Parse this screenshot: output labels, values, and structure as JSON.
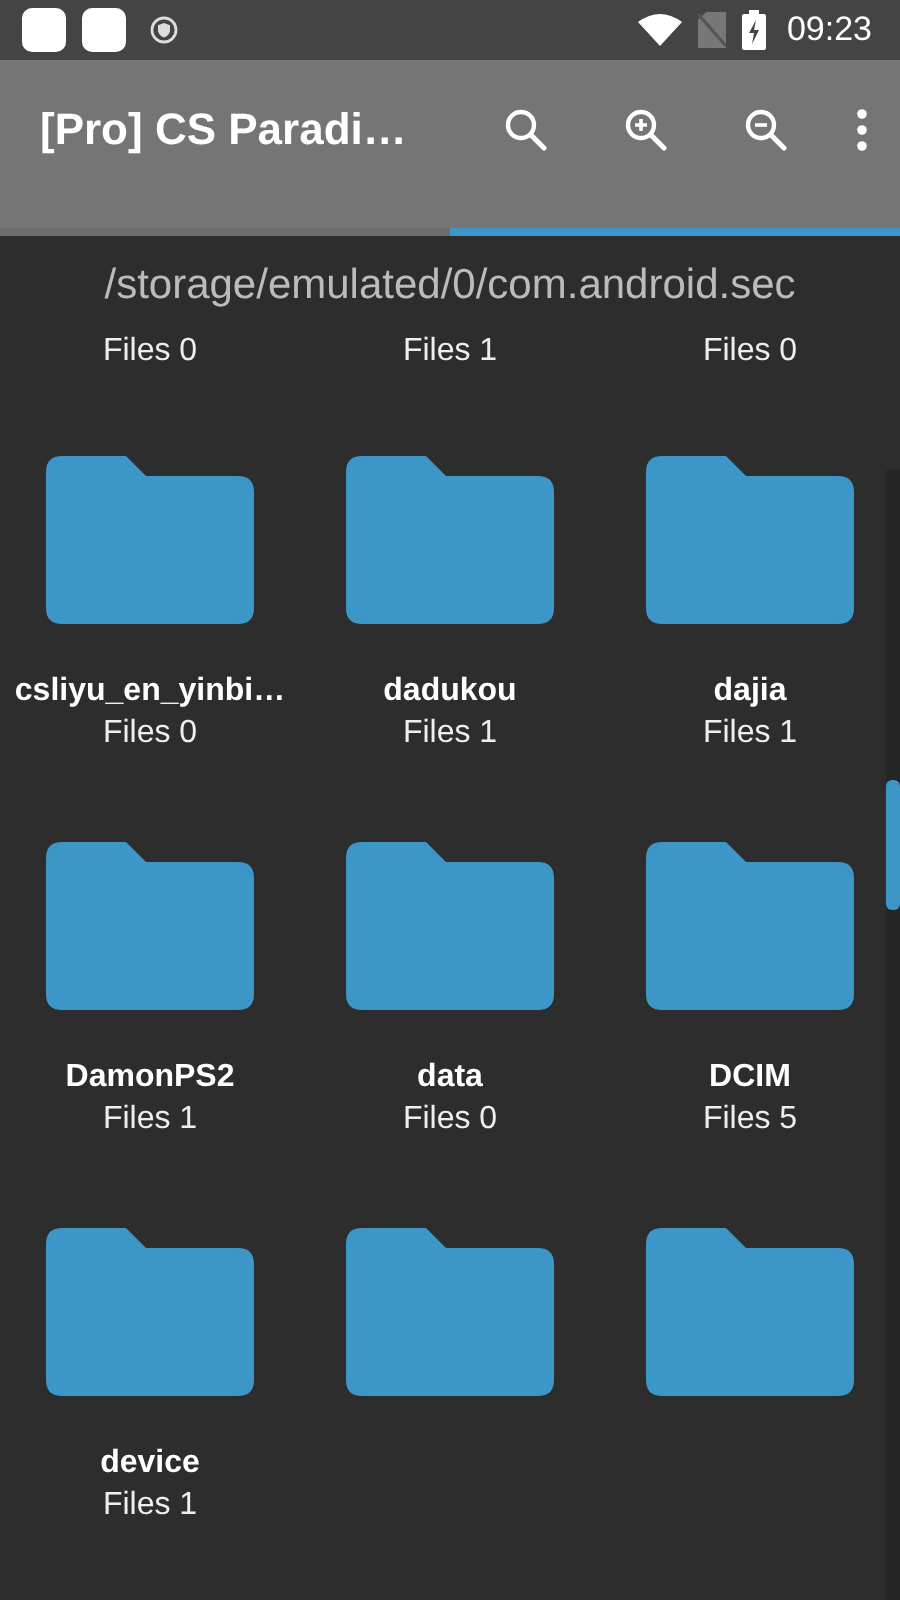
{
  "status_bar": {
    "time": "09:23"
  },
  "app_bar": {
    "title": "[Pro] CS Paradi…"
  },
  "tabs": [
    {
      "selected": false
    },
    {
      "selected": true
    }
  ],
  "path": "/storage/emulated/0/com.android.sec",
  "partial_row": [
    {
      "files": "Files 0"
    },
    {
      "files": "Files 1"
    },
    {
      "files": "Files 0"
    }
  ],
  "folders": [
    {
      "kind": "folder",
      "name": "csliyu_en_yinbi…",
      "files": "Files 0"
    },
    {
      "kind": "folder",
      "name": "dadukou",
      "files": "Files 1"
    },
    {
      "kind": "folder",
      "name": "dajia",
      "files": "Files 1"
    },
    {
      "kind": "folder",
      "name": "DamonPS2",
      "files": "Files 1"
    },
    {
      "kind": "folder",
      "name": "data",
      "files": "Files 0"
    },
    {
      "kind": "folder",
      "name": "DCIM",
      "files": "Files 5"
    },
    {
      "kind": "folder",
      "name": "device",
      "files": "Files 1"
    },
    {
      "kind": "folder"
    },
    {
      "kind": "folder"
    }
  ]
}
